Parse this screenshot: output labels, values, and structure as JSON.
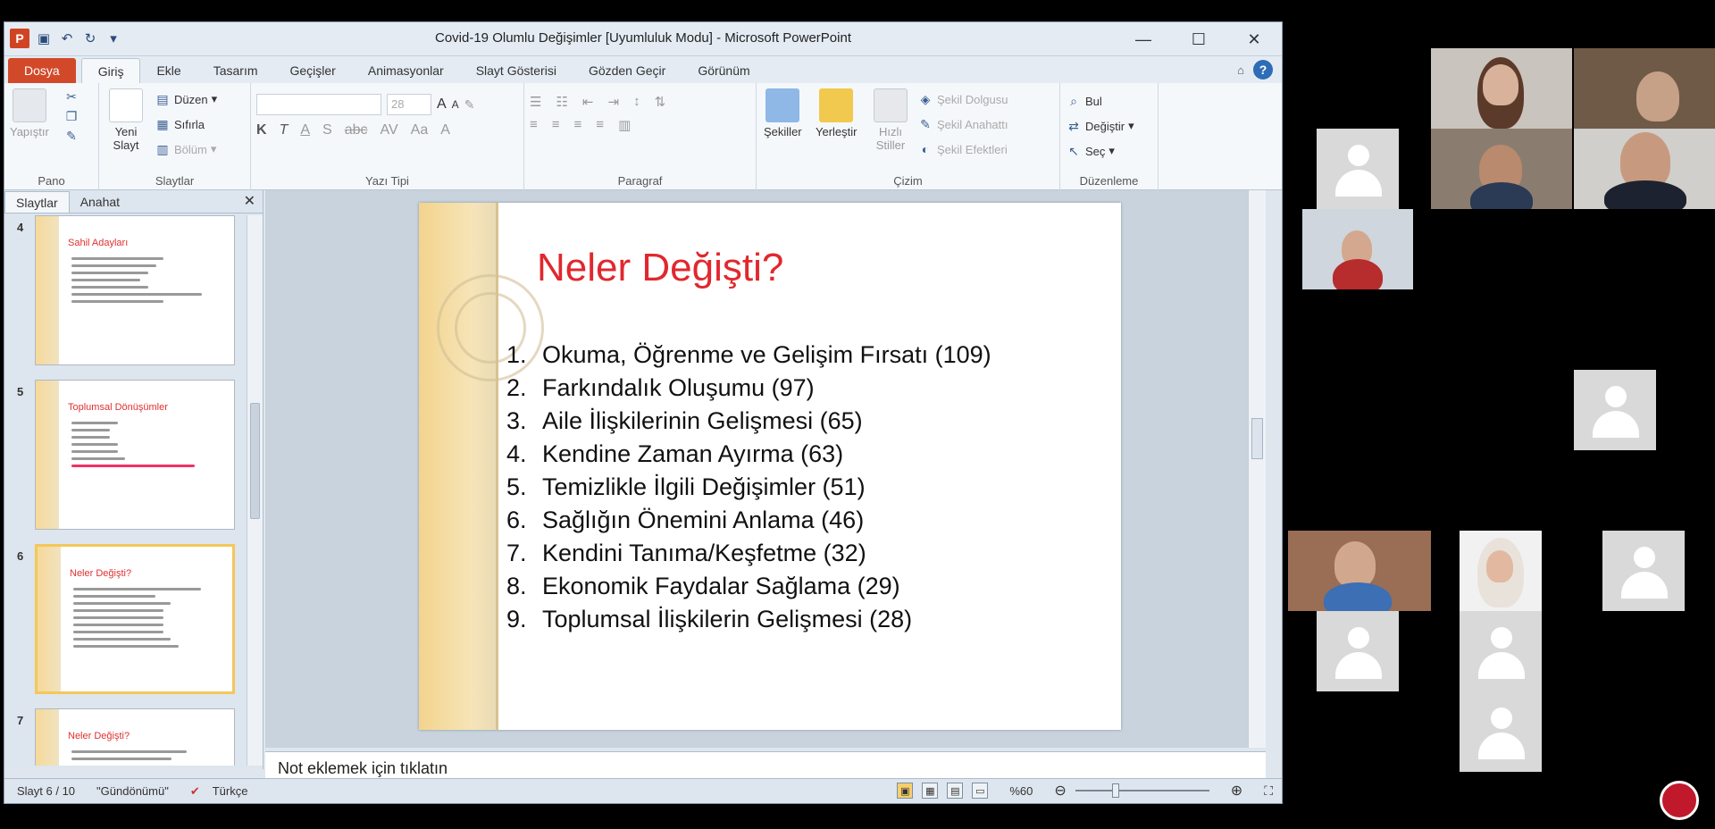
{
  "window": {
    "title": "Covid-19 Olumlu Değişimler [Uyumluluk Modu] - Microsoft PowerPoint"
  },
  "tabs": [
    "Dosya",
    "Giriş",
    "Ekle",
    "Tasarım",
    "Geçişler",
    "Animasyonlar",
    "Slayt Gösterisi",
    "Gözden Geçir",
    "Görünüm"
  ],
  "ribbon": {
    "pano": {
      "label": "Pano",
      "paste": "Yapıştır"
    },
    "slaytlar": {
      "label": "Slaytlar",
      "new_slide": "Yeni Slayt",
      "layout": "Düzen",
      "reset": "Sıfırla",
      "section": "Bölüm"
    },
    "yazi_tipi": {
      "label": "Yazı Tipi",
      "size": "28"
    },
    "paragraf": {
      "label": "Paragraf"
    },
    "cizim": {
      "label": "Çizim",
      "shapes": "Şekiller",
      "arrange": "Yerleştir",
      "quick_styles": "Hızlı Stiller",
      "fill": "Şekil Dolgusu",
      "outline": "Şekil Anahattı",
      "effects": "Şekil Efektleri"
    },
    "duzenleme": {
      "label": "Düzenleme",
      "find": "Bul",
      "replace": "Değiştir",
      "select": "Seç"
    }
  },
  "pane": {
    "tabs": [
      "Slaytlar",
      "Anahat"
    ],
    "thumbs": [
      {
        "num": "4",
        "title": "Sahil Adayları"
      },
      {
        "num": "5",
        "title": "Toplumsal Dönüşümler"
      },
      {
        "num": "6",
        "title": "Neler Değişti?"
      },
      {
        "num": "7",
        "title": "Neler Değişti?"
      }
    ]
  },
  "slide": {
    "title": "Neler Değişti?",
    "items": [
      {
        "n": "1.",
        "text": "Okuma, Öğrenme ve Gelişim Fırsatı (109)"
      },
      {
        "n": "2.",
        "text": "Farkındalık Oluşumu (97)"
      },
      {
        "n": "3.",
        "text": "Aile İlişkilerinin Gelişmesi (65)"
      },
      {
        "n": "4.",
        "text": "Kendine Zaman Ayırma (63)"
      },
      {
        "n": "5.",
        "text": "Temizlikle İlgili Değişimler (51)"
      },
      {
        "n": "6.",
        "text": "Sağlığın Önemini Anlama (46)"
      },
      {
        "n": "7.",
        "text": "Kendini Tanıma/Keşfetme (32)"
      },
      {
        "n": "8.",
        "text": "Ekonomik Faydalar Sağlama (29)"
      },
      {
        "n": "9.",
        "text": "Toplumsal İlişkilerin Gelişmesi (28)"
      }
    ]
  },
  "notes": {
    "placeholder": "Not eklemek için tıklatın"
  },
  "status": {
    "slide": "Slayt 6 / 10",
    "theme": "\"Gündönümü\"",
    "language": "Türkçe",
    "zoom": "%60",
    "zoom_fraction": 0.3
  },
  "colors": {
    "title_red": "#e0282e",
    "file_tab": "#d2492a",
    "selected_thumb": "#f3c75a"
  }
}
